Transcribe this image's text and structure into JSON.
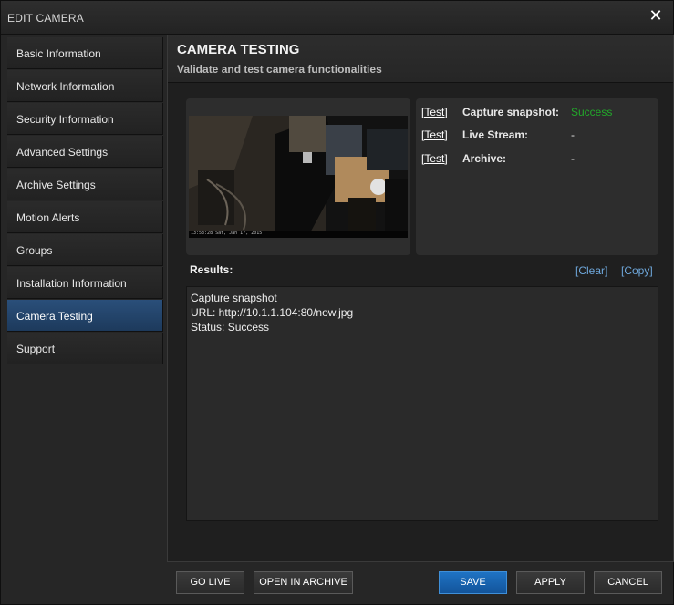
{
  "window": {
    "title": "EDIT CAMERA"
  },
  "sidebar": {
    "items": [
      {
        "label": "Basic Information"
      },
      {
        "label": "Network Information"
      },
      {
        "label": "Security Information"
      },
      {
        "label": "Advanced Settings"
      },
      {
        "label": "Archive Settings"
      },
      {
        "label": "Motion Alerts"
      },
      {
        "label": "Groups"
      },
      {
        "label": "Installation Information"
      },
      {
        "label": "Camera Testing",
        "active": true
      },
      {
        "label": "Support"
      }
    ]
  },
  "header": {
    "title": "CAMERA TESTING",
    "subtitle": "Validate and test camera functionalities"
  },
  "preview": {
    "timestamp": "13:53:28 Sat, Jan 17, 2015"
  },
  "tests": [
    {
      "link": "[Test]",
      "label": "Capture snapshot:",
      "value": "Success"
    },
    {
      "link": "[Test]",
      "label": "Live Stream:",
      "value": "-"
    },
    {
      "link": "[Test]",
      "label": "Archive:",
      "value": "-"
    }
  ],
  "results": {
    "label": "Results:",
    "clear": "[Clear]",
    "copy": "[Copy]",
    "lines": [
      "Capture snapshot",
      "URL: http://10.1.1.104:80/now.jpg",
      "Status: Success"
    ]
  },
  "footer": {
    "go_live": "GO LIVE",
    "open_archive": "OPEN IN ARCHIVE",
    "save": "SAVE",
    "apply": "APPLY",
    "cancel": "CANCEL"
  },
  "colors": {
    "success": "#22a82a",
    "active_nav": "#2a4f7a",
    "link": "#6fa8dc",
    "primary_button": "#1f73c4"
  }
}
